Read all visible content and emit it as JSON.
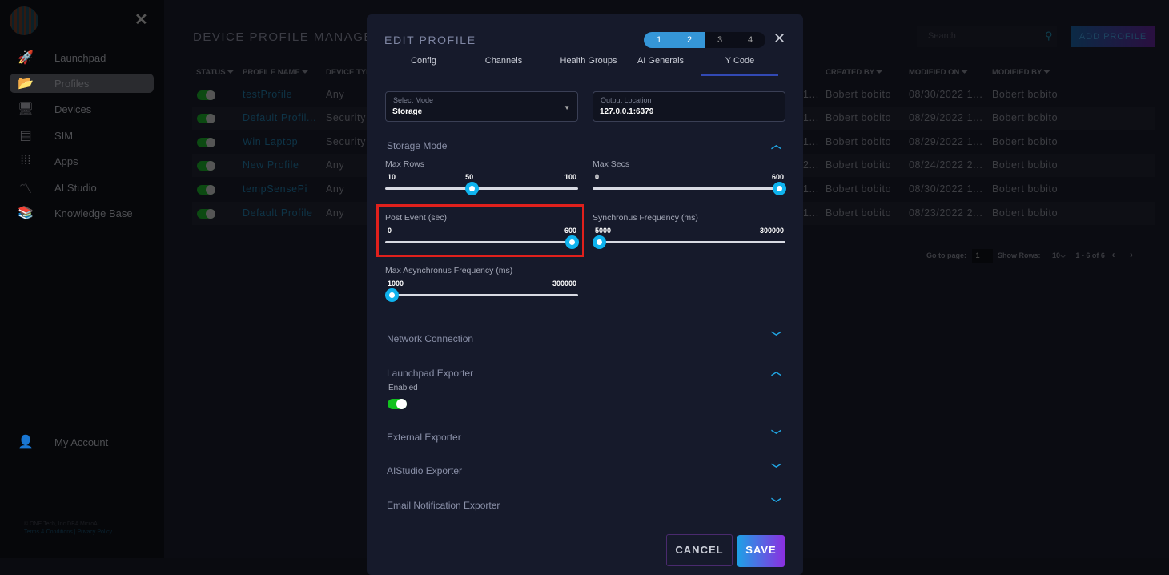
{
  "sidebar": {
    "items": [
      {
        "label": "Launchpad",
        "icon": "rocket-icon",
        "glyph": "🚀"
      },
      {
        "label": "Profiles",
        "icon": "folder-open-icon",
        "glyph": "📂",
        "active": true
      },
      {
        "label": "Devices",
        "icon": "monitor-icon",
        "glyph": "🖥"
      },
      {
        "label": "SIM",
        "icon": "sim-card-icon",
        "glyph": "▤"
      },
      {
        "label": "Apps",
        "icon": "grid-icon",
        "glyph": "⁞⁞⁞"
      },
      {
        "label": "AI Studio",
        "icon": "ai-studio-icon",
        "glyph": "〽"
      },
      {
        "label": "Knowledge Base",
        "icon": "books-icon",
        "glyph": "📚"
      }
    ],
    "account": "My Account",
    "copyright": "© ONE Tech, Inc DBA MicroAI",
    "terms": "Terms & Conditions",
    "privacy": "Privacy Policy",
    "sep": "|"
  },
  "page": {
    "title": "DEVICE PROFILE MANAGEM",
    "search_placeholder": "Search",
    "add_button": "ADD PROFILE",
    "columns": [
      "STATUS",
      "PROFILE NAME",
      "DEVICE TYP",
      "CREATED BY",
      "MODIFIED ON",
      "MODIFIED BY"
    ],
    "rows": [
      {
        "name": "testProfile",
        "type": "Any",
        "created_on": "1...",
        "created_by": "Bobert bobito",
        "modified_on": "08/30/2022 1...",
        "modified_by": "Bobert bobito",
        "enabled": true
      },
      {
        "name": "Default Profil...",
        "type": "Security",
        "created_on": "1...",
        "created_by": "Bobert bobito",
        "modified_on": "08/29/2022 1...",
        "modified_by": "Bobert bobito",
        "enabled": true
      },
      {
        "name": "Win Laptop",
        "type": "Security",
        "created_on": "1...",
        "created_by": "Bobert bobito",
        "modified_on": "08/29/2022 1...",
        "modified_by": "Bobert bobito",
        "enabled": true
      },
      {
        "name": "New Profile",
        "type": "Any",
        "created_on": "2...",
        "created_by": "Bobert bobito",
        "modified_on": "08/24/2022 2...",
        "modified_by": "Bobert bobito",
        "enabled": true
      },
      {
        "name": "tempSensePi",
        "type": "Any",
        "created_on": "1...",
        "created_by": "Bobert bobito",
        "modified_on": "08/30/2022 1...",
        "modified_by": "Bobert bobito",
        "enabled": true
      },
      {
        "name": "Default Profile",
        "type": "Any",
        "created_on": "1...",
        "created_by": "Bobert bobito",
        "modified_on": "08/23/2022 2...",
        "modified_by": "Bobert bobito",
        "enabled": true
      }
    ],
    "pagination": {
      "goto_label": "Go to page:",
      "page": "1",
      "rows_label": "Show Rows:",
      "rows": "10",
      "range": "1 - 6 of 6"
    }
  },
  "modal": {
    "title": "EDIT PROFILE",
    "steps": [
      "1",
      "2",
      "3",
      "4"
    ],
    "completed_steps": 2,
    "tabs": [
      "Config",
      "Channels",
      "Health Groups",
      "AI Generals",
      "Y Code"
    ],
    "active_tab": "Y Code",
    "select_mode": {
      "label": "Select Mode",
      "value": "Storage"
    },
    "output_location": {
      "label": "Output Location",
      "value": "127.0.0.1:6379"
    },
    "storage_mode": "Storage Mode",
    "sliders": [
      {
        "label": "Max Rows",
        "min": 10,
        "max": 100,
        "value": 50,
        "show_value": true
      },
      {
        "label": "Max Secs",
        "min": 0,
        "max": 600,
        "value": 600
      },
      {
        "label": "Post Event (sec)",
        "min": 0,
        "max": 600,
        "value": 600,
        "highlighted": true
      },
      {
        "label": "Synchronus Frequency (ms)",
        "min": 5000,
        "max": 300000,
        "value": 5000
      },
      {
        "label": "Max Asynchronus Frequency (ms)",
        "min": 1000,
        "max": 300000,
        "value": 1000
      }
    ],
    "sections": [
      "Network Connection",
      "Launchpad Exporter",
      "External Exporter",
      "AIStudio Exporter",
      "Email Notification Exporter"
    ],
    "enabled_label": "Enabled",
    "launchpad_enabled": true,
    "cancel": "CANCEL",
    "save": "SAVE",
    "highlight_color": "#e0201c",
    "accent": "#0fb3ee"
  }
}
